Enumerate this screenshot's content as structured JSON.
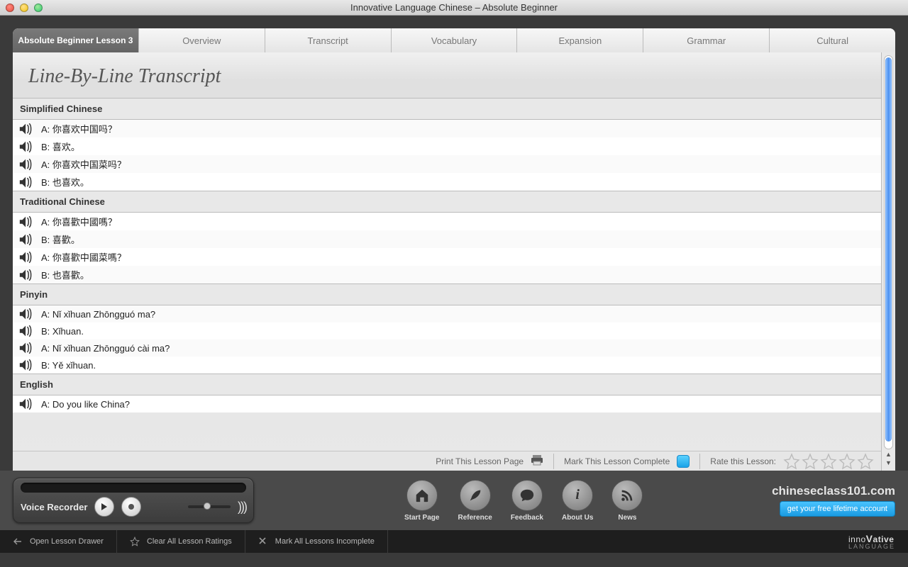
{
  "window": {
    "title": "Innovative Language Chinese – Absolute Beginner"
  },
  "tabs": [
    {
      "label": "Absolute Beginner Lesson 3",
      "active": true
    },
    {
      "label": "Overview"
    },
    {
      "label": "Transcript"
    },
    {
      "label": "Vocabulary"
    },
    {
      "label": "Expansion"
    },
    {
      "label": "Grammar"
    },
    {
      "label": "Cultural"
    }
  ],
  "page": {
    "heading": "Line-By-Line Transcript"
  },
  "sections": [
    {
      "title": "Simplified Chinese",
      "lines": [
        {
          "speaker": "A",
          "text": "你喜欢中国吗？"
        },
        {
          "speaker": "B",
          "text": "喜欢。"
        },
        {
          "speaker": "A",
          "text": "你喜欢中国菜吗？"
        },
        {
          "speaker": "B",
          "text": "也喜欢。"
        }
      ]
    },
    {
      "title": "Traditional Chinese",
      "lines": [
        {
          "speaker": "A",
          "text": "你喜歡中國嗎？"
        },
        {
          "speaker": "B",
          "text": "喜歡。"
        },
        {
          "speaker": "A",
          "text": "你喜歡中國菜嗎？"
        },
        {
          "speaker": "B",
          "text": "也喜歡。"
        }
      ]
    },
    {
      "title": "Pinyin",
      "lines": [
        {
          "speaker": "A",
          "text": "Nǐ xǐhuan Zhōngguó ma?"
        },
        {
          "speaker": "B",
          "text": "Xǐhuan."
        },
        {
          "speaker": "A",
          "text": "Nǐ xǐhuan Zhōngguó cài ma?"
        },
        {
          "speaker": "B",
          "text": "Yě xǐhuan."
        }
      ]
    },
    {
      "title": "English",
      "lines": [
        {
          "speaker": "A",
          "text": "Do you like China?"
        }
      ]
    }
  ],
  "actions": {
    "print": "Print This Lesson Page",
    "mark_complete": "Mark This Lesson Complete",
    "rate_label": "Rate this Lesson:"
  },
  "recorder": {
    "label": "Voice Recorder"
  },
  "nav": [
    {
      "label": "Start Page"
    },
    {
      "label": "Reference"
    },
    {
      "label": "Feedback"
    },
    {
      "label": "About Us"
    },
    {
      "label": "News"
    }
  ],
  "brand": {
    "site": "chineseclass101.com",
    "cta": "get your free lifetime account"
  },
  "footer": {
    "open_drawer": "Open Lesson Drawer",
    "clear_ratings": "Clear All Lesson Ratings",
    "mark_incomplete": "Mark All Lessons Incomplete",
    "brand_line1a": "inno",
    "brand_line1b": "ative",
    "brand_line2": "LANGUAGE"
  }
}
